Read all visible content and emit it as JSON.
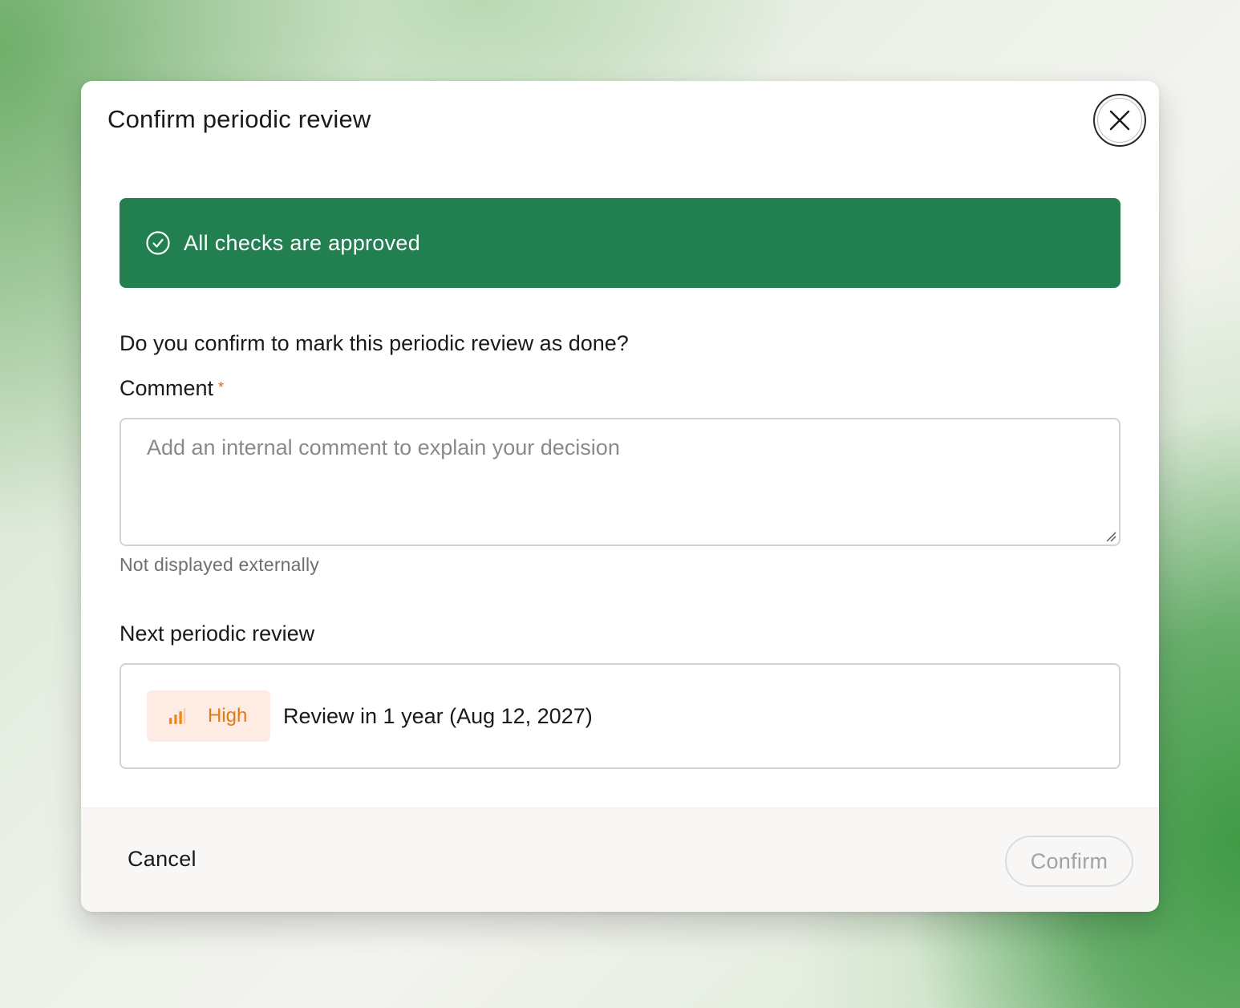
{
  "modal": {
    "title": "Confirm periodic review",
    "close_icon": "close-icon"
  },
  "banner": {
    "icon": "check-circle-icon",
    "text": "All checks are approved",
    "background_color": "#217f50"
  },
  "form": {
    "question": "Do you confirm to mark this periodic review as done?",
    "comment": {
      "label": "Comment",
      "required_marker": "*",
      "value": "",
      "placeholder": "Add an internal comment to explain your decision",
      "helper": "Not displayed externally"
    },
    "next_review": {
      "label": "Next periodic review",
      "priority": {
        "icon": "signal-bars-icon",
        "label": "High",
        "color": "#e07b12"
      },
      "text": "Review in 1 year (Aug 12, 2027)"
    }
  },
  "footer": {
    "cancel_label": "Cancel",
    "confirm_label": "Confirm",
    "confirm_disabled": true
  }
}
